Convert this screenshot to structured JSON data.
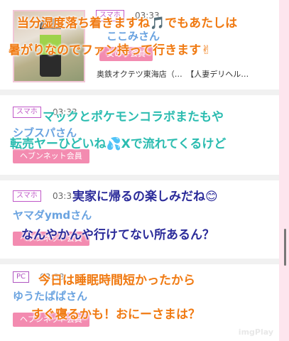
{
  "posts": [
    {
      "badge": "スマホ",
      "time": "03:33",
      "user": "ここみさん",
      "role": "女の子会員",
      "shop": "奥鉄オクテツ東海店（…　【人妻デリヘル…"
    },
    {
      "badge": "スマホ",
      "time": "03:33",
      "user": "シブスパさん",
      "role": "ヘブンネット会員"
    },
    {
      "badge": "スマホ",
      "time": "03:33",
      "user": "ヤマダymdさん",
      "role": "ヘブンネット会員"
    },
    {
      "badge": "PC",
      "time": "03:33",
      "user": "ゆうたぱぱさん",
      "role": "ヘブンネット会員"
    }
  ],
  "overlays": [
    {
      "text": "当分湿度落ち着きますね🎵でもあたしは",
      "color": "orange"
    },
    {
      "text": "暑がりなのでファン持って行きます✌",
      "color": "orange"
    },
    {
      "text": "マックとポケモンコラボまたもや",
      "color": "teal"
    },
    {
      "text": "転売ヤーひどいね💦Xで流れてくるけど",
      "color": "teal"
    },
    {
      "text": "実家に帰るの楽しみだね😊",
      "color": "navy"
    },
    {
      "text": "なんやかんや行けてない所あるん？",
      "color": "navy"
    },
    {
      "text": "今日は睡眠時間短かったから",
      "color": "orange"
    },
    {
      "text": "すぐ寝るかも！おにーさまは？",
      "color": "orange"
    }
  ],
  "watermark": "imgPlay"
}
